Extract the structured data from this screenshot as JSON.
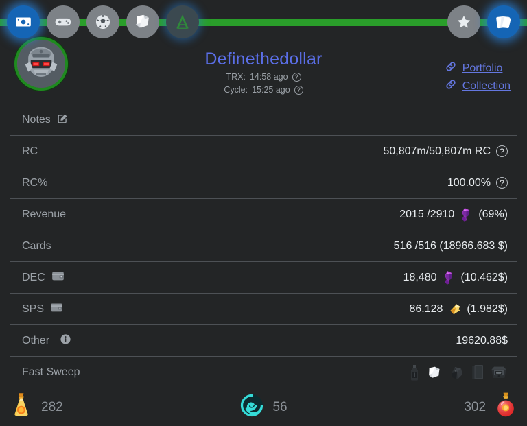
{
  "topnav": {
    "left_items": [
      {
        "name": "money-icon",
        "label": "Money",
        "active": true
      },
      {
        "name": "gamepad-icon",
        "label": "Battle",
        "active": false
      },
      {
        "name": "soccer-ball-icon",
        "label": "Guild",
        "active": false
      },
      {
        "name": "scroll-icon",
        "label": "Quests",
        "active": false
      },
      {
        "name": "arcane-a-icon",
        "label": "Arcane",
        "active": false
      }
    ],
    "right_items": [
      {
        "name": "star-icon",
        "label": "Favorites",
        "active": false
      },
      {
        "name": "cards-icon",
        "label": "Cards",
        "active": true
      }
    ]
  },
  "header": {
    "avatar_name": "robot-mech-avatar",
    "title": "Definethedollar",
    "trx_label": "TRX:",
    "trx_value": "14:58 ago",
    "cycle_label": "Cycle:",
    "cycle_value": "15:25 ago",
    "help_glyph": "?",
    "links": [
      {
        "label": "Portfolio",
        "icon": "link-icon"
      },
      {
        "label": "Collection",
        "icon": "link-icon"
      }
    ]
  },
  "rows": [
    {
      "id": "notes",
      "label": "Notes",
      "label_icon": "edit-pencil-icon",
      "value": "",
      "suffix_icon": ""
    },
    {
      "id": "rc",
      "label": "RC",
      "label_icon": "",
      "value": "50,807m/50,807m RC",
      "suffix_icon": "help-circle-icon"
    },
    {
      "id": "rc-percent",
      "label": "RC%",
      "label_icon": "",
      "value": "100.00%",
      "suffix_icon": "help-circle-icon"
    },
    {
      "id": "revenue",
      "label": "Revenue",
      "label_icon": "",
      "value_pre": "2015 /2910",
      "token_icon": "dec-crystal-icon",
      "value_post": "(69%)"
    },
    {
      "id": "cards",
      "label": "Cards",
      "label_icon": "",
      "value": "516 /516 (18966.683 $)",
      "suffix_icon": ""
    },
    {
      "id": "dec",
      "label": "DEC",
      "label_icon": "wallet-icon",
      "value_pre": "18,480",
      "token_icon": "dec-crystal-icon",
      "value_post": "(10.462$)"
    },
    {
      "id": "sps",
      "label": "SPS",
      "label_icon": "wallet-icon",
      "value_pre": "86.128",
      "token_icon": "sps-shard-icon",
      "value_post": "(1.982$)"
    },
    {
      "id": "other",
      "label": "Other",
      "label_icon": "info-circle-icon",
      "value": "19620.88$",
      "suffix_icon": ""
    },
    {
      "id": "fast-sweep",
      "label": "Fast Sweep",
      "label_icon": "",
      "value": "",
      "sweep_icons": [
        "dark-bottle-icon",
        "white-scroll-icon",
        "dark-crystal-icon",
        "dark-card-icon",
        "dark-chest-icon"
      ]
    }
  ],
  "bottombar": {
    "items": [
      {
        "icon": "gold-potion-icon",
        "count": "282",
        "align": "left"
      },
      {
        "icon": "teal-vortex-icon",
        "count": "56",
        "align": "center"
      },
      {
        "icon": "red-potion-icon",
        "count": "302",
        "align": "right"
      }
    ]
  },
  "colors": {
    "background": "#232526",
    "accent_green": "#2a9e2a",
    "accent_blue": "#1565b5",
    "title_blue": "#5b6fe8",
    "link_blue": "#6477e0",
    "divider": "#4d5155",
    "label_grey": "#9ba1a7",
    "value_white": "#e9edf0"
  }
}
